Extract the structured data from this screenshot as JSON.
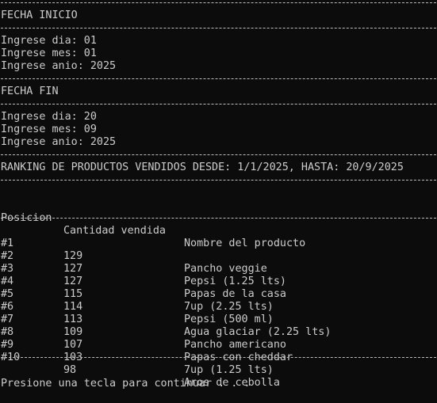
{
  "start_section": {
    "title": "FECHA INICIO",
    "day": "Ingrese dia: 01",
    "month": "Ingrese mes: 01",
    "year": "Ingrese anio: 2025"
  },
  "end_section": {
    "title": "FECHA FIN",
    "day": "Ingrese dia: 20",
    "month": "Ingrese mes: 09",
    "year": "Ingrese anio: 2025"
  },
  "ranking": {
    "title": "RANKING DE PRODUCTOS VENDIDOS DESDE: 1/1/2025, HASTA: 20/9/2025",
    "headers": {
      "position": "Posicion",
      "quantity": "Cantidad vendida",
      "name": "Nombre del producto"
    },
    "rows": [
      {
        "pos": "#1",
        "qty": "129",
        "name": "Pancho veggie"
      },
      {
        "pos": "#2",
        "qty": "127",
        "name": "Pepsi (1.25 lts)"
      },
      {
        "pos": "#3",
        "qty": "127",
        "name": "Papas de la casa"
      },
      {
        "pos": "#4",
        "qty": "115",
        "name": "7up (2.25 lts)"
      },
      {
        "pos": "#5",
        "qty": "114",
        "name": "Pepsi (500 ml)"
      },
      {
        "pos": "#6",
        "qty": "113",
        "name": "Agua glaciar (2.25 lts)"
      },
      {
        "pos": "#7",
        "qty": "109",
        "name": "Pancho americano"
      },
      {
        "pos": "#8",
        "qty": "107",
        "name": "Papas con cheddar"
      },
      {
        "pos": "#9",
        "qty": "103",
        "name": "7up (1.25 lts)"
      },
      {
        "pos": "#10",
        "qty": "98",
        "name": "Aros de cebolla"
      }
    ]
  },
  "prompt": "Presione una tecla para continuar . . ."
}
